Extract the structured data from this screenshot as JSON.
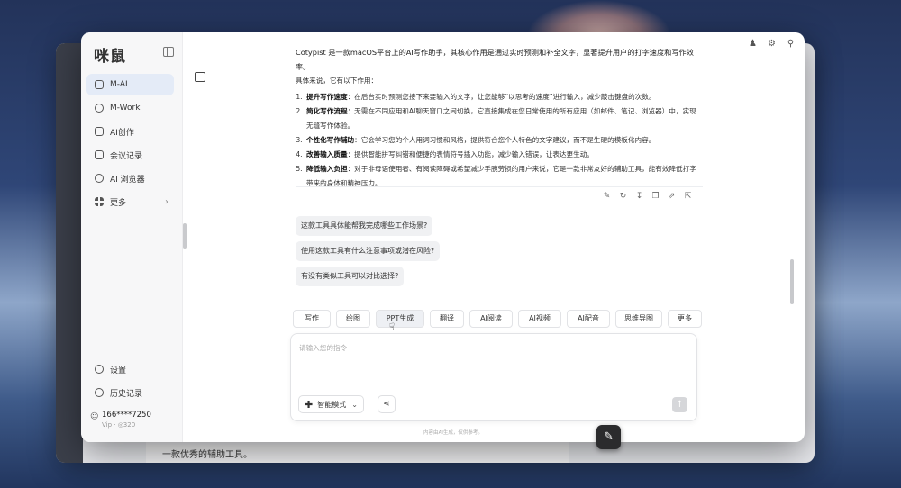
{
  "app": {
    "logo": "咪鼠"
  },
  "sidebar": {
    "items": [
      {
        "label": "M-AI",
        "icon": "chat-icon"
      },
      {
        "label": "M-Work",
        "icon": "work-icon"
      },
      {
        "label": "AI创作",
        "icon": "image-icon"
      },
      {
        "label": "会议记录",
        "icon": "meeting-icon"
      },
      {
        "label": "AI 浏览器",
        "icon": "browser-icon"
      },
      {
        "label": "更多",
        "icon": "grid-icon"
      }
    ],
    "settings_label": "设置",
    "history_label": "历史记录",
    "user": {
      "name": "166****7250",
      "vip": "Vip  ·  ◎320"
    }
  },
  "answer": {
    "intro": "Cotypist 是一款macOS平台上的AI写作助手，其核心作用是通过实时预测和补全文字，显著提升用户的打字速度和写作效率。",
    "intro2": "具体来说，它有以下作用：",
    "points": [
      {
        "title": "提升写作速度",
        "text": "：在后台实时预测您接下来要输入的文字，让您能够“以思考的速度”进行输入，减少敲击键盘的次数。"
      },
      {
        "title": "简化写作流程",
        "text": "：无需在不同应用和AI聊天窗口之间切换，它直接集成在您日常使用的所有应用（如邮件、笔记、浏览器）中，实现无缝写作体验。"
      },
      {
        "title": "个性化写作辅助",
        "text": "：它会学习您的个人用词习惯和风格，提供符合您个人特色的文字建议，而不是生硬的模板化内容。"
      },
      {
        "title": "改善输入质量",
        "text": "：提供智能拼写纠错和便捷的表情符号插入功能，减少输入错误，让表达更生动。"
      },
      {
        "title": "降低输入负担",
        "text": "：对于非母语使用者、有阅读障碍或希望减少手腕劳损的用户来说，它是一款非常友好的辅助工具，能有效降低打字带来的身体和精神压力。"
      }
    ]
  },
  "suggestions": [
    "这款工具具体能帮我完成哪些工作场景?",
    "使用这款工具有什么注意事项或潜在风险?",
    "有没有类似工具可以对比选择?"
  ],
  "tools": [
    "写作",
    "绘图",
    "PPT生成",
    "翻译",
    "AI阅读",
    "AI视频",
    "AI配音",
    "思维导图",
    "更多"
  ],
  "composer": {
    "placeholder": "请输入您的指令",
    "mode_label": "智能模式",
    "disclaimer": "内容由AI生成，仅供参考。"
  },
  "background": {
    "text": "一款优秀的辅助工具。"
  }
}
